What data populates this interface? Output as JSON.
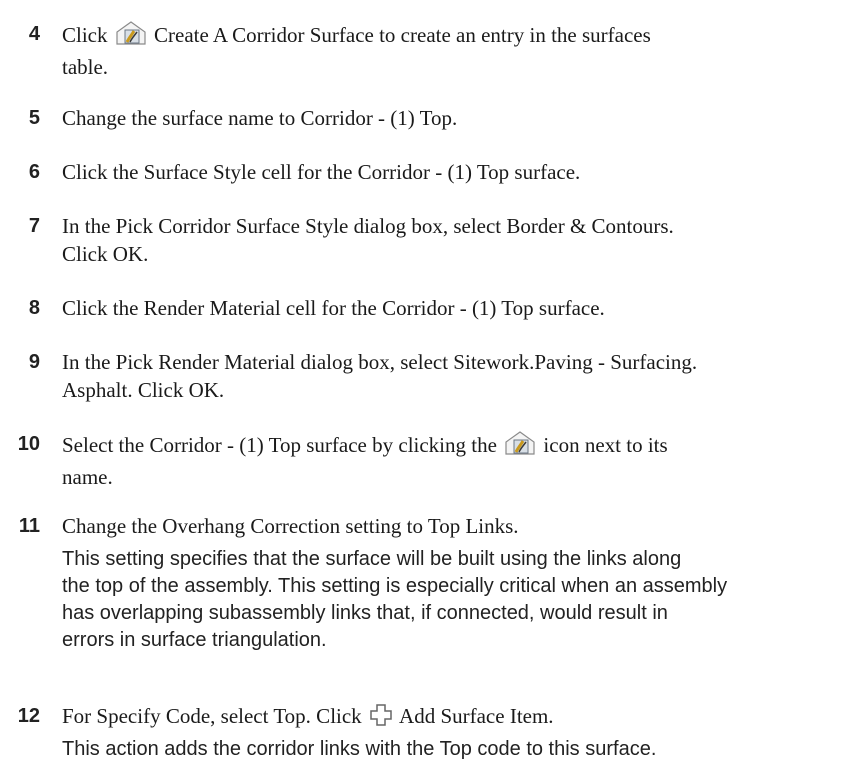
{
  "steps": [
    {
      "num": "4",
      "before": "Click",
      "after": "Create A Corridor Surface to create an entry in the surfaces",
      "line2": "table.",
      "icon": "corridor-surface-icon"
    },
    {
      "num": "5",
      "text": "Change the surface name to Corridor - (1) Top."
    },
    {
      "num": "6",
      "text": "Click the Surface Style cell for the Corridor - (1) Top surface."
    },
    {
      "num": "7",
      "text": "In the Pick Corridor Surface Style dialog box, select Border & Contours.",
      "line2": "Click OK."
    },
    {
      "num": "8",
      "text": "Click the Render Material cell for the Corridor - (1) Top surface."
    },
    {
      "num": "9",
      "text": "In the Pick Render Material dialog box, select Sitework.Paving - Surfacing.",
      "line2": "Asphalt. Click OK."
    },
    {
      "num": "10",
      "before": "Select the Corridor - (1) Top surface by clicking the",
      "after": "icon next to its",
      "line2": "name.",
      "icon": "corridor-surface-icon"
    },
    {
      "num": "11",
      "text": "Change the Overhang Correction setting to Top Links.",
      "note": [
        "This setting specifies that the surface will be built using the links along",
        "the top of the assembly. This setting is especially critical when an assembly",
        "has overlapping subassembly links that, if connected, would result in",
        "errors in surface triangulation."
      ]
    },
    {
      "num": "12",
      "before": "For Specify Code, select Top. Click",
      "after": "Add Surface Item.",
      "icon": "add-plus-icon",
      "note": [
        "This action adds the corridor links with the Top code to this surface."
      ]
    }
  ]
}
